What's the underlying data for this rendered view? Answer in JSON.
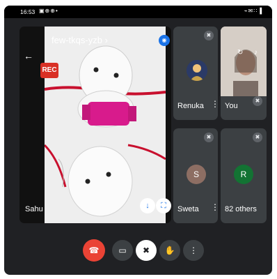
{
  "status_bar": {
    "time": "16:53",
    "left_icons": "▣⊕⊕•",
    "right_icons": "⌁✉∷▐"
  },
  "meeting": {
    "code": "few-tkqs-yzb",
    "code_chevron": "›",
    "rec_label": "REC"
  },
  "main_tile": {
    "name": "Sahu"
  },
  "participants": [
    {
      "name": "Renuka",
      "muted": true
    },
    {
      "name": "You",
      "muted": true
    },
    {
      "name": "Sweta",
      "initial": "S",
      "muted": true
    },
    {
      "name": "82 others",
      "initial": "R",
      "muted": true
    }
  ],
  "icons": {
    "back": "←",
    "more": "⋮",
    "mic_off": "✖",
    "pin": "↓",
    "fullscreen": "⛶",
    "end_call": "☎",
    "camera": "▭",
    "hand": "✋",
    "camera_flip": "↻",
    "sound": "♪",
    "camera_switch": "◉"
  },
  "colors": {
    "background": "#202124",
    "tile": "#3c4043",
    "end_call": "#ea4335",
    "rec": "#d93025",
    "accent": "#1a73e8"
  }
}
